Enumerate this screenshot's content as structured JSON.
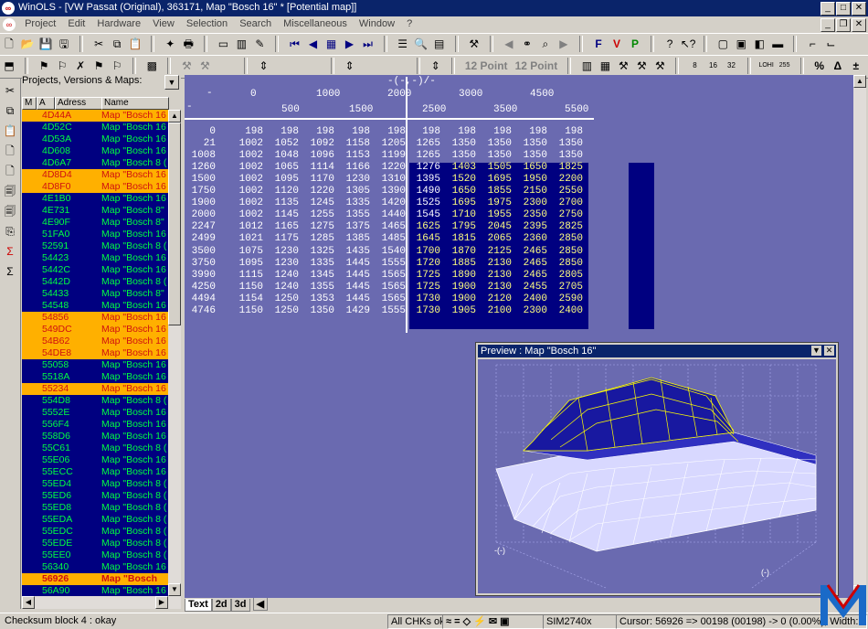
{
  "window": {
    "title": "WinOLS - [VW Passat (Original), 363171, Map \"Bosch 16\" *  [Potential map]]"
  },
  "menu": [
    "Project",
    "Edit",
    "Hardware",
    "View",
    "Selection",
    "Search",
    "Miscellaneous",
    "Window",
    "?"
  ],
  "toolbar": {
    "font1": "12 Point",
    "font2": "12 Point"
  },
  "project_panel": {
    "title": "Projects, Versions & Maps:",
    "col_m": "M",
    "col_a": "A",
    "col_address": "Adress",
    "col_name": "Name"
  },
  "maps": [
    {
      "addr": "4D44A",
      "name": "Map \"Bosch 16",
      "color": "orange"
    },
    {
      "addr": "4D52C",
      "name": "Map \"Bosch 16",
      "color": "blue"
    },
    {
      "addr": "4D53A",
      "name": "Map \"Bosch 16",
      "color": "blue"
    },
    {
      "addr": "4D608",
      "name": "Map \"Bosch 16",
      "color": "blue"
    },
    {
      "addr": "4D6A7",
      "name": "Map \"Bosch 8 (",
      "color": "blue"
    },
    {
      "addr": "4D8D4",
      "name": "Map \"Bosch 16",
      "color": "orange"
    },
    {
      "addr": "4D8F0",
      "name": "Map \"Bosch 16",
      "color": "orange"
    },
    {
      "addr": "4E1B0",
      "name": "Map \"Bosch 16",
      "color": "blue"
    },
    {
      "addr": "4E731",
      "name": "Map \"Bosch 8\"",
      "color": "blue"
    },
    {
      "addr": "4E90F",
      "name": "Map \"Bosch 8\"",
      "color": "blue"
    },
    {
      "addr": "51FA0",
      "name": "Map \"Bosch 16",
      "color": "blue"
    },
    {
      "addr": "52591",
      "name": "Map \"Bosch 8 (",
      "color": "blue"
    },
    {
      "addr": "54423",
      "name": "Map \"Bosch 16",
      "color": "blue"
    },
    {
      "addr": "5442C",
      "name": "Map \"Bosch 16",
      "color": "blue"
    },
    {
      "addr": "5442D",
      "name": "Map \"Bosch 8 (",
      "color": "blue"
    },
    {
      "addr": "54433",
      "name": "Map \"Bosch 8\"",
      "color": "blue"
    },
    {
      "addr": "54548",
      "name": "Map \"Bosch 16",
      "color": "blue"
    },
    {
      "addr": "54856",
      "name": "Map \"Bosch 16",
      "color": "orange"
    },
    {
      "addr": "549DC",
      "name": "Map \"Bosch 16",
      "color": "orange"
    },
    {
      "addr": "54B62",
      "name": "Map \"Bosch 16",
      "color": "orange"
    },
    {
      "addr": "54DE8",
      "name": "Map \"Bosch 16",
      "color": "orange"
    },
    {
      "addr": "55058",
      "name": "Map \"Bosch 16",
      "color": "blue"
    },
    {
      "addr": "5518A",
      "name": "Map \"Bosch 16",
      "color": "blue"
    },
    {
      "addr": "55234",
      "name": "Map \"Bosch 16",
      "color": "orange"
    },
    {
      "addr": "554D8",
      "name": "Map \"Bosch 8 (",
      "color": "blue"
    },
    {
      "addr": "5552E",
      "name": "Map \"Bosch 16",
      "color": "blue"
    },
    {
      "addr": "556F4",
      "name": "Map \"Bosch 16",
      "color": "blue"
    },
    {
      "addr": "558D6",
      "name": "Map \"Bosch 16",
      "color": "blue"
    },
    {
      "addr": "55C61",
      "name": "Map \"Bosch 8 (",
      "color": "blue"
    },
    {
      "addr": "55E06",
      "name": "Map \"Bosch 16",
      "color": "blue"
    },
    {
      "addr": "55ECC",
      "name": "Map \"Bosch 16",
      "color": "blue"
    },
    {
      "addr": "55ED4",
      "name": "Map \"Bosch 8 (",
      "color": "blue"
    },
    {
      "addr": "55ED6",
      "name": "Map \"Bosch 8 (",
      "color": "blue"
    },
    {
      "addr": "55ED8",
      "name": "Map \"Bosch 8 (",
      "color": "blue"
    },
    {
      "addr": "55EDA",
      "name": "Map \"Bosch 8 (",
      "color": "blue"
    },
    {
      "addr": "55EDC",
      "name": "Map \"Bosch 8 (",
      "color": "blue"
    },
    {
      "addr": "55EDE",
      "name": "Map \"Bosch 8 (",
      "color": "blue"
    },
    {
      "addr": "55EE0",
      "name": "Map \"Bosch 8 (",
      "color": "blue"
    },
    {
      "addr": "56340",
      "name": "Map \"Bosch 16",
      "color": "blue"
    },
    {
      "addr": "56926",
      "name": "Map \"Bosch",
      "color": "sel"
    },
    {
      "addr": "56A90",
      "name": "Map \"Bosch 16",
      "color": "blue"
    }
  ],
  "map": {
    "x_unit": "-(-,-)/-",
    "y_unit": "-",
    "z_unit": "-",
    "x_axis": [
      "0",
      "500",
      "1000",
      "1500",
      "2000",
      "2500",
      "3000",
      "3500",
      "4500",
      "5500"
    ],
    "y_axis": [
      "0",
      "21",
      "1008",
      "1260",
      "1500",
      "1750",
      "1900",
      "2000",
      "2247",
      "2499",
      "3500",
      "3750",
      "3990",
      "4250",
      "4494",
      "4746"
    ],
    "rows": [
      [
        "198",
        "198",
        "198",
        "198",
        "198",
        "198",
        "198",
        "198",
        "198",
        "198"
      ],
      [
        "1002",
        "1052",
        "1092",
        "1158",
        "1205",
        "1265",
        "1350",
        "1350",
        "1350",
        "1350"
      ],
      [
        "1002",
        "1048",
        "1096",
        "1153",
        "1199",
        "1265",
        "1350",
        "1350",
        "1350",
        "1350"
      ],
      [
        "1002",
        "1065",
        "1114",
        "1166",
        "1220",
        "1276",
        "1403",
        "1505",
        "1650",
        "1825"
      ],
      [
        "1002",
        "1095",
        "1170",
        "1230",
        "1310",
        "1395",
        "1520",
        "1695",
        "1950",
        "2200"
      ],
      [
        "1002",
        "1120",
        "1220",
        "1305",
        "1390",
        "1490",
        "1650",
        "1855",
        "2150",
        "2550"
      ],
      [
        "1002",
        "1135",
        "1245",
        "1335",
        "1420",
        "1525",
        "1695",
        "1975",
        "2300",
        "2700"
      ],
      [
        "1002",
        "1145",
        "1255",
        "1355",
        "1440",
        "1545",
        "1710",
        "1955",
        "2350",
        "2750"
      ],
      [
        "1012",
        "1165",
        "1275",
        "1375",
        "1465",
        "1625",
        "1795",
        "2045",
        "2395",
        "2825"
      ],
      [
        "1021",
        "1175",
        "1285",
        "1385",
        "1485",
        "1645",
        "1815",
        "2065",
        "2360",
        "2850"
      ],
      [
        "1075",
        "1230",
        "1325",
        "1435",
        "1540",
        "1700",
        "1870",
        "2125",
        "2465",
        "2850"
      ],
      [
        "1095",
        "1230",
        "1335",
        "1445",
        "1555",
        "1720",
        "1885",
        "2130",
        "2465",
        "2850"
      ],
      [
        "1115",
        "1240",
        "1345",
        "1445",
        "1565",
        "1725",
        "1890",
        "2130",
        "2465",
        "2805"
      ],
      [
        "1150",
        "1240",
        "1355",
        "1445",
        "1565",
        "1725",
        "1900",
        "2130",
        "2455",
        "2705"
      ],
      [
        "1154",
        "1250",
        "1353",
        "1445",
        "1565",
        "1730",
        "1900",
        "2120",
        "2400",
        "2590"
      ],
      [
        "1150",
        "1250",
        "1350",
        "1429",
        "1555",
        "1730",
        "1905",
        "2100",
        "2300",
        "2400"
      ]
    ]
  },
  "preview": {
    "title": "Preview : Map \"Bosch 16\"",
    "xlab": "-(-)",
    "ylab": "(-)"
  },
  "tabs": [
    "Text",
    "2d",
    "3d"
  ],
  "status": {
    "checksum": "Checksum block 4 : okay",
    "chks": "All CHKs ok",
    "eq": "=",
    "ecu": "SIM2740x",
    "cursor": "Cursor: 56926 => 00198 (00198) -> 0 (0.00%), Width: 10"
  }
}
